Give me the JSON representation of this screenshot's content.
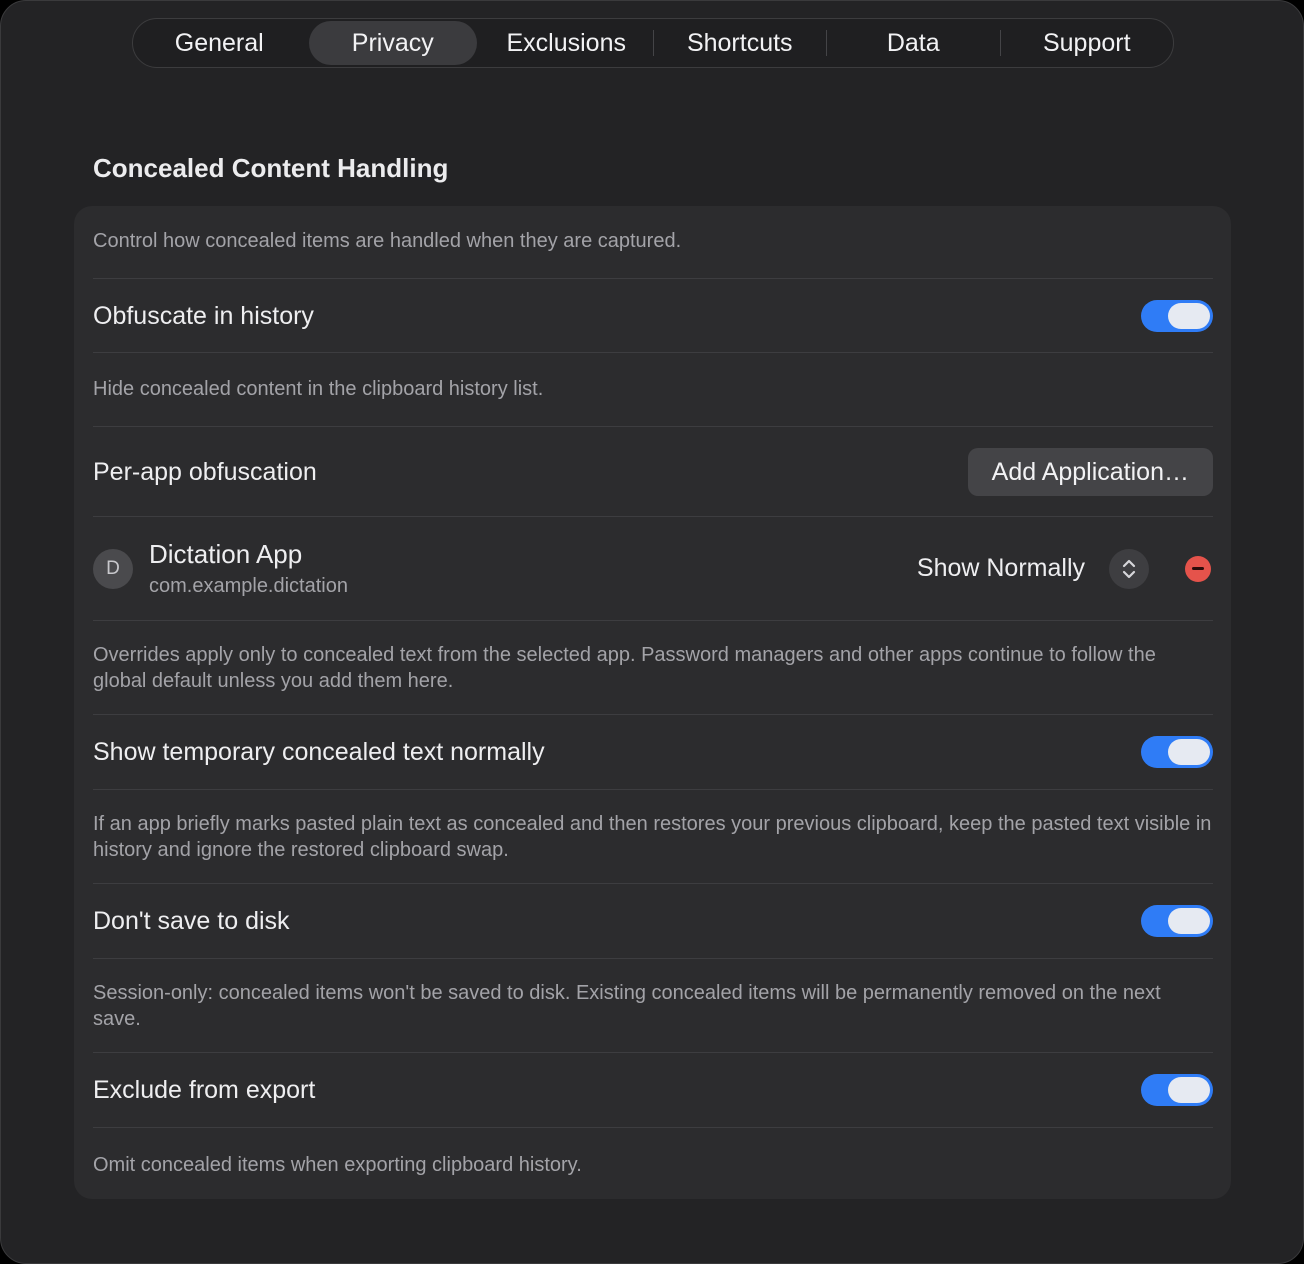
{
  "tabs": [
    {
      "label": "General",
      "active": false
    },
    {
      "label": "Privacy",
      "active": true
    },
    {
      "label": "Exclusions",
      "active": false
    },
    {
      "label": "Shortcuts",
      "active": false
    },
    {
      "label": "Data",
      "active": false
    },
    {
      "label": "Support",
      "active": false
    }
  ],
  "section": {
    "title": "Concealed Content Handling",
    "intro": "Control how concealed items are handled when they are captured."
  },
  "obfuscate": {
    "label": "Obfuscate in history",
    "enabled": true,
    "desc": "Hide concealed content in the clipboard history list."
  },
  "per_app": {
    "label": "Per-app obfuscation",
    "add_button": "Add Application…",
    "apps": [
      {
        "initial": "D",
        "name": "Dictation App",
        "bundle_id": "com.example.dictation",
        "mode": "Show Normally"
      }
    ],
    "desc": "Overrides apply only to concealed text from the selected app. Password managers and other apps continue to follow the global default unless you add them here."
  },
  "temporary": {
    "label": "Show temporary concealed text normally",
    "enabled": true,
    "desc": "If an app briefly marks pasted plain text as concealed and then restores your previous clipboard, keep the pasted text visible in history and ignore the restored clipboard swap."
  },
  "no_disk": {
    "label": "Don't save to disk",
    "enabled": true,
    "desc": "Session-only: concealed items won't be saved to disk. Existing concealed items will be permanently removed on the next save."
  },
  "export": {
    "label": "Exclude from export",
    "enabled": true,
    "desc": "Omit concealed items when exporting clipboard history."
  },
  "colors": {
    "accent": "#2f7cf6",
    "destructive": "#e5534b",
    "window_bg": "#232325",
    "card_bg": "#2c2c2e"
  }
}
